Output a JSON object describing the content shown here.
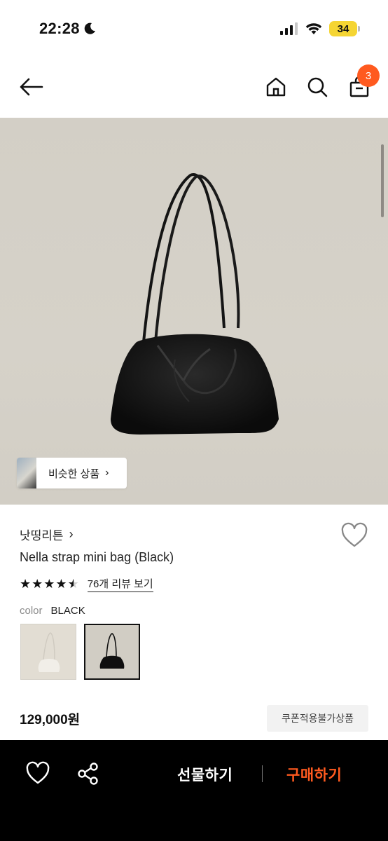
{
  "status_bar": {
    "time": "22:28",
    "battery": "34"
  },
  "nav": {
    "cart_count": "3"
  },
  "hero": {
    "similar_label": "비슷한 상품"
  },
  "product": {
    "brand": "낫띵리튼",
    "name": "Nella strap mini bag (Black)",
    "rating": 4.5,
    "stars": [
      "★",
      "★",
      "★",
      "★",
      "★"
    ],
    "review_link": "76개 리뷰 보기",
    "color_label": "color",
    "color_value": "BLACK",
    "price": "129,000원",
    "coupon_badge": "쿠폰적용불가상품"
  },
  "bottom_bar": {
    "gift_label": "선물하기",
    "buy_label": "구매하기"
  },
  "colors": {
    "accent": "#ff5a1f",
    "bar_bg": "#000000"
  }
}
